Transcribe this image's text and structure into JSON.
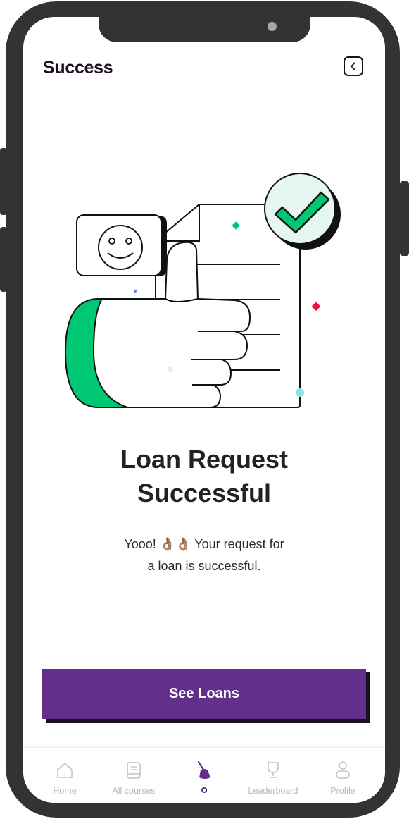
{
  "header": {
    "title": "Success"
  },
  "icons": {
    "back": "chevron-left-icon",
    "smiley": "smiley-icon",
    "check": "check-icon"
  },
  "headline": {
    "line1": "Loan Request",
    "line2": "Successful"
  },
  "message": {
    "line1": "Yooo! 👌🏽👌🏽 Your request for",
    "line2": "a loan is successful."
  },
  "cta": {
    "label": "See Loans"
  },
  "tabbar": {
    "items": [
      {
        "label": "Home",
        "icon": "home-icon",
        "active": false
      },
      {
        "label": "All courses",
        "icon": "book-icon",
        "active": false
      },
      {
        "label": "",
        "icon": "broom-icon",
        "active": true
      },
      {
        "label": "Leaderboard",
        "icon": "trophy-icon",
        "active": false
      },
      {
        "label": "Profile",
        "icon": "user-icon",
        "active": false
      }
    ]
  },
  "colors": {
    "primary": "#62308a",
    "accent_green": "#00c774",
    "check_bg": "#e6f7ef",
    "ink": "#1c0f1f",
    "frame": "#333333",
    "sparkle_red": "#ea1047",
    "sparkle_teal": "#8fe2df",
    "sparkle_blue": "#5b7cf5"
  }
}
